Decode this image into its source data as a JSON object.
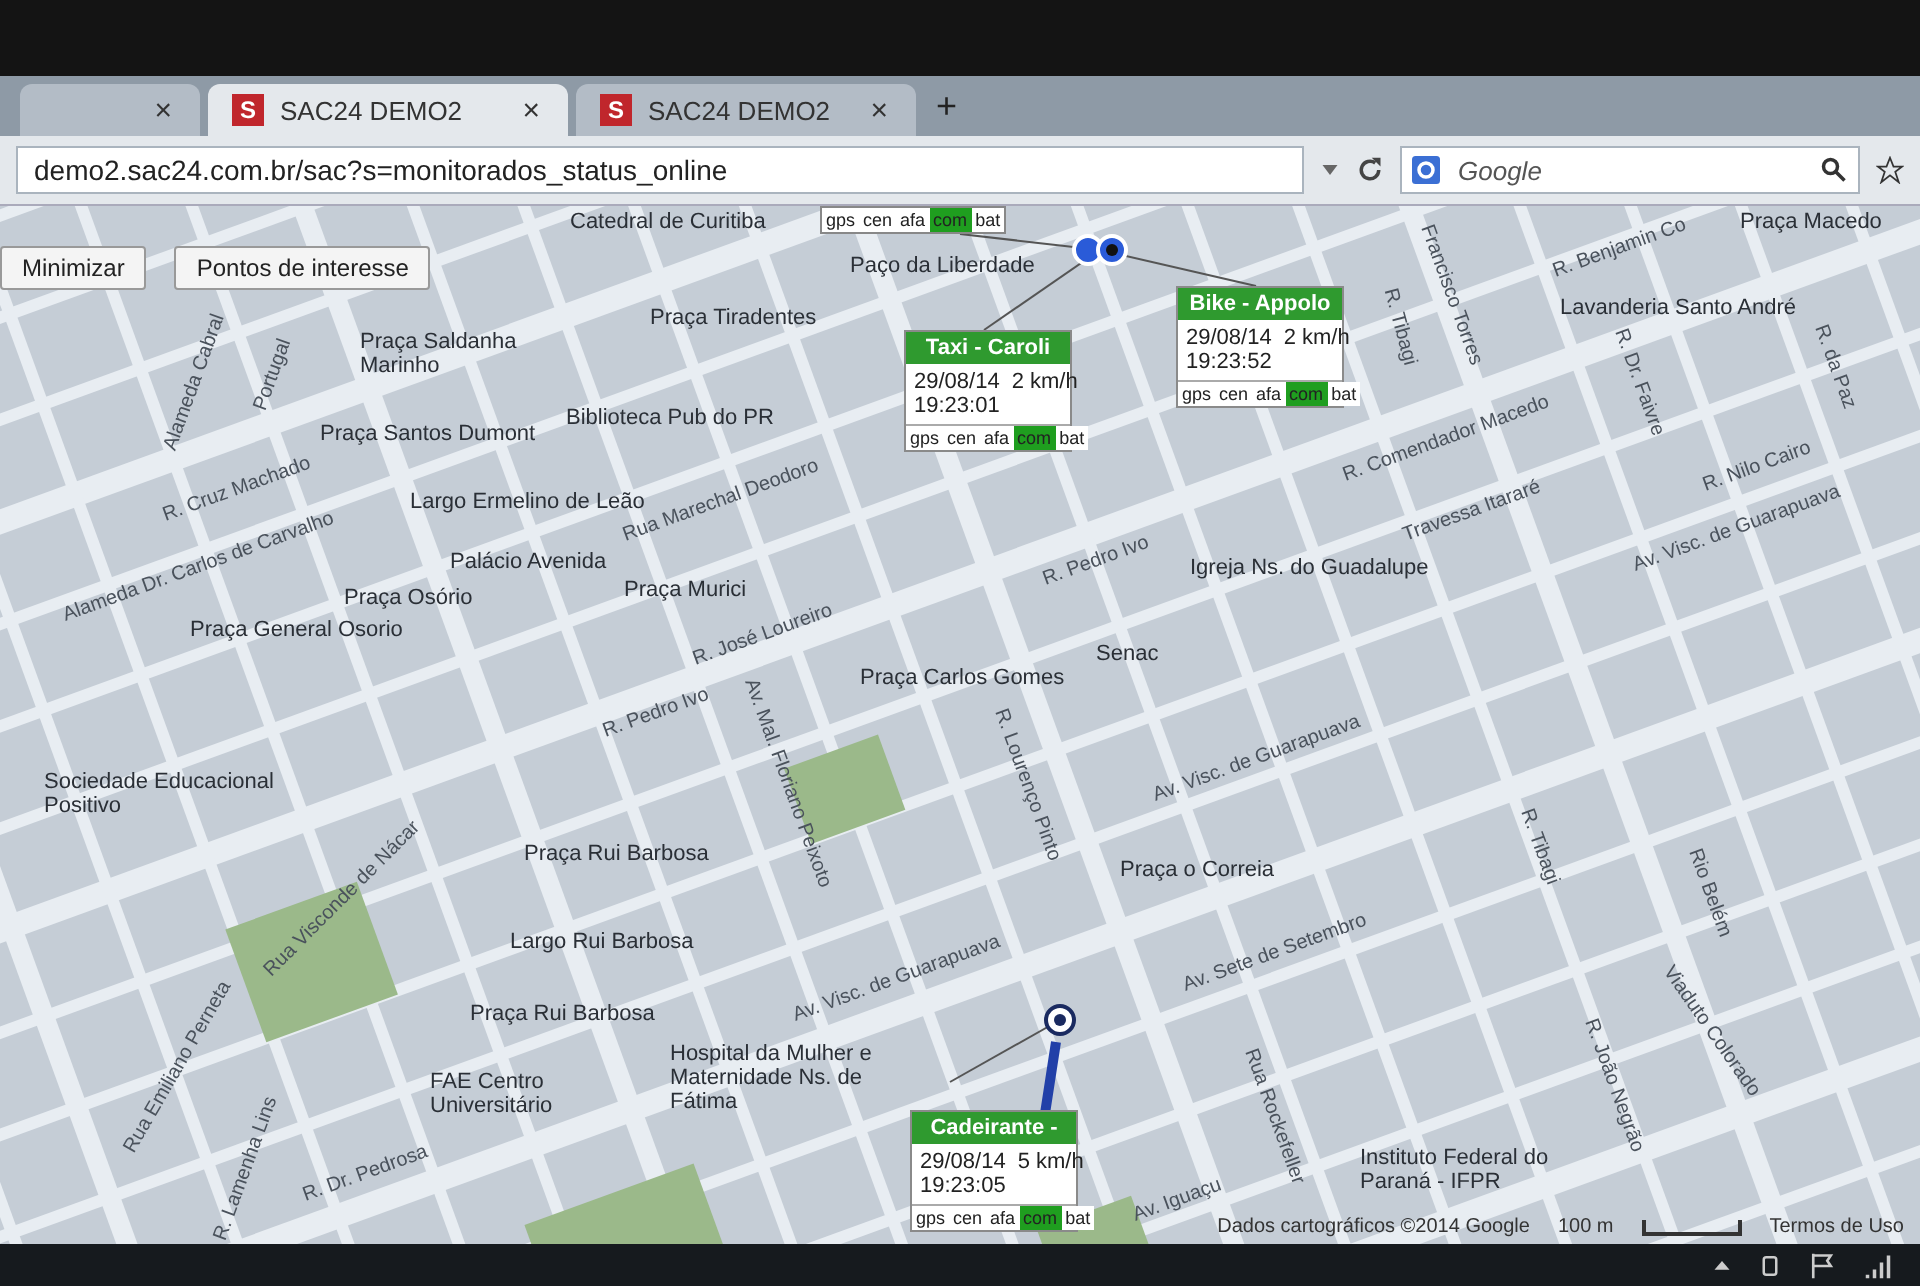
{
  "browser": {
    "tabs": [
      {
        "close": "×",
        "selected": false
      },
      {
        "favicon": "S",
        "title": "SAC24 DEMO2",
        "close": "×",
        "selected": true
      },
      {
        "favicon": "S",
        "title": "SAC24 DEMO2",
        "close": "×",
        "selected": false
      }
    ],
    "new_tab": "+",
    "address": "demo2.sac24.com.br/sac?s=monitorados_status_online",
    "search": {
      "placeholder": "Google"
    }
  },
  "map": {
    "buttons": [
      "Minimizar",
      "Pontos de interesse"
    ],
    "status_row": [
      {
        "label": "gps",
        "on": false
      },
      {
        "label": "cen",
        "on": false
      },
      {
        "label": "afa",
        "on": false
      },
      {
        "label": "com",
        "on": true
      },
      {
        "label": "bat",
        "on": false
      }
    ],
    "vehicles": [
      {
        "name": "Taxi - Caroli",
        "date": "29/08/14",
        "time": "19:23:01",
        "speed": "2 km/h",
        "status": [
          {
            "label": "gps",
            "on": false
          },
          {
            "label": "cen",
            "on": false
          },
          {
            "label": "afa",
            "on": false
          },
          {
            "label": "com",
            "on": true
          },
          {
            "label": "bat",
            "on": false
          }
        ]
      },
      {
        "name": "Bike - Appolo",
        "date": "29/08/14",
        "time": "19:23:52",
        "speed": "2 km/h",
        "status": [
          {
            "label": "gps",
            "on": false
          },
          {
            "label": "cen",
            "on": false
          },
          {
            "label": "afa",
            "on": false
          },
          {
            "label": "com",
            "on": true
          },
          {
            "label": "bat",
            "on": false
          }
        ]
      },
      {
        "name": "Cadeirante -",
        "date": "29/08/14",
        "time": "19:23:05",
        "speed": "5 km/h",
        "status": [
          {
            "label": "gps",
            "on": false
          },
          {
            "label": "cen",
            "on": false
          },
          {
            "label": "afa",
            "on": false
          },
          {
            "label": "com",
            "on": true
          },
          {
            "label": "bat",
            "on": false
          }
        ]
      }
    ],
    "labels": [
      {
        "text": "Catedral de Curitiba",
        "kind": "place"
      },
      {
        "text": "Paço da Liberdade",
        "kind": "place"
      },
      {
        "text": "Praça Tiradentes",
        "kind": "place"
      },
      {
        "text": "Praça Saldanha Marinho",
        "kind": "place"
      },
      {
        "text": "Praça Santos Dumont",
        "kind": "place"
      },
      {
        "text": "Biblioteca Pub do PR",
        "kind": "place"
      },
      {
        "text": "Largo Ermelino de Leão",
        "kind": "place"
      },
      {
        "text": "Palácio Avenida",
        "kind": "place"
      },
      {
        "text": "Praça Murici",
        "kind": "place"
      },
      {
        "text": "Praça Osório",
        "kind": "place"
      },
      {
        "text": "Praça General Osorio",
        "kind": "place"
      },
      {
        "text": "Praça Carlos Gomes",
        "kind": "place"
      },
      {
        "text": "Senac",
        "kind": "place"
      },
      {
        "text": "Igreja Ns. do Guadalupe",
        "kind": "place"
      },
      {
        "text": "Sociedade Educacional Positivo",
        "kind": "place"
      },
      {
        "text": "Praça Rui Barbosa",
        "kind": "place"
      },
      {
        "text": "Largo Rui Barbosa",
        "kind": "place"
      },
      {
        "text": "Praça Rui Barbosa",
        "kind": "place"
      },
      {
        "text": "FAE Centro Universitário",
        "kind": "place"
      },
      {
        "text": "Hospital da Mulher e Maternidade Ns. de Fátima",
        "kind": "place"
      },
      {
        "text": "Praça o Correia",
        "kind": "place"
      },
      {
        "text": "Instituto Federal do Paraná - IFPR",
        "kind": "place"
      },
      {
        "text": "Lavanderia Santo André",
        "kind": "place"
      },
      {
        "text": "Praça Macedo",
        "kind": "place"
      },
      {
        "text": "Alameda Cabral",
        "kind": "street"
      },
      {
        "text": "Portugal",
        "kind": "street"
      },
      {
        "text": "R. Cruz Machado",
        "kind": "street"
      },
      {
        "text": "Alameda Dr. Carlos de Carvalho",
        "kind": "street"
      },
      {
        "text": "R. José Loureiro",
        "kind": "street"
      },
      {
        "text": "Rua Marechal Deodoro",
        "kind": "street"
      },
      {
        "text": "R. Pedro Ivo",
        "kind": "street"
      },
      {
        "text": "R. Pedro Ivo",
        "kind": "street"
      },
      {
        "text": "Av. Mal. Floriano Peixoto",
        "kind": "street"
      },
      {
        "text": "R. Lourenço Pinto",
        "kind": "street"
      },
      {
        "text": "Av. Visc. de Guarapuava",
        "kind": "street"
      },
      {
        "text": "Av. Visc. de Guarapuava",
        "kind": "street"
      },
      {
        "text": "Av. Visc. de Guarapuava",
        "kind": "street"
      },
      {
        "text": "Av. Sete de Setembro",
        "kind": "street"
      },
      {
        "text": "R. Comendador Macedo",
        "kind": "street"
      },
      {
        "text": "Travessa Itararé",
        "kind": "street"
      },
      {
        "text": "R. Nilo Cairo",
        "kind": "street"
      },
      {
        "text": "R. Tibagi",
        "kind": "street"
      },
      {
        "text": "Francisco Torres",
        "kind": "street"
      },
      {
        "text": "R. Benjamin Co",
        "kind": "street"
      },
      {
        "text": "R. Dr. Pedrosa",
        "kind": "street"
      },
      {
        "text": "Rua Emiliano Perneta",
        "kind": "street"
      },
      {
        "text": "Viaduto Colorado",
        "kind": "street"
      },
      {
        "text": "Rio Belém",
        "kind": "street"
      },
      {
        "text": "Av. Iguaçu",
        "kind": "street"
      },
      {
        "text": "Rua Rockefeller",
        "kind": "street"
      },
      {
        "text": "R. João Negrão",
        "kind": "street"
      },
      {
        "text": "R. Dr. Faivre",
        "kind": "street"
      },
      {
        "text": "R. da Paz",
        "kind": "street"
      },
      {
        "text": "R. Lamenha Lins",
        "kind": "street"
      },
      {
        "text": "Rua Visconde de Nácar",
        "kind": "street"
      },
      {
        "text": "R. Tibagi",
        "kind": "street"
      }
    ],
    "footer": {
      "attribution": "Dados cartográficos ©2014 Google",
      "scale": "100 m",
      "terms": "Termos de Uso"
    }
  }
}
